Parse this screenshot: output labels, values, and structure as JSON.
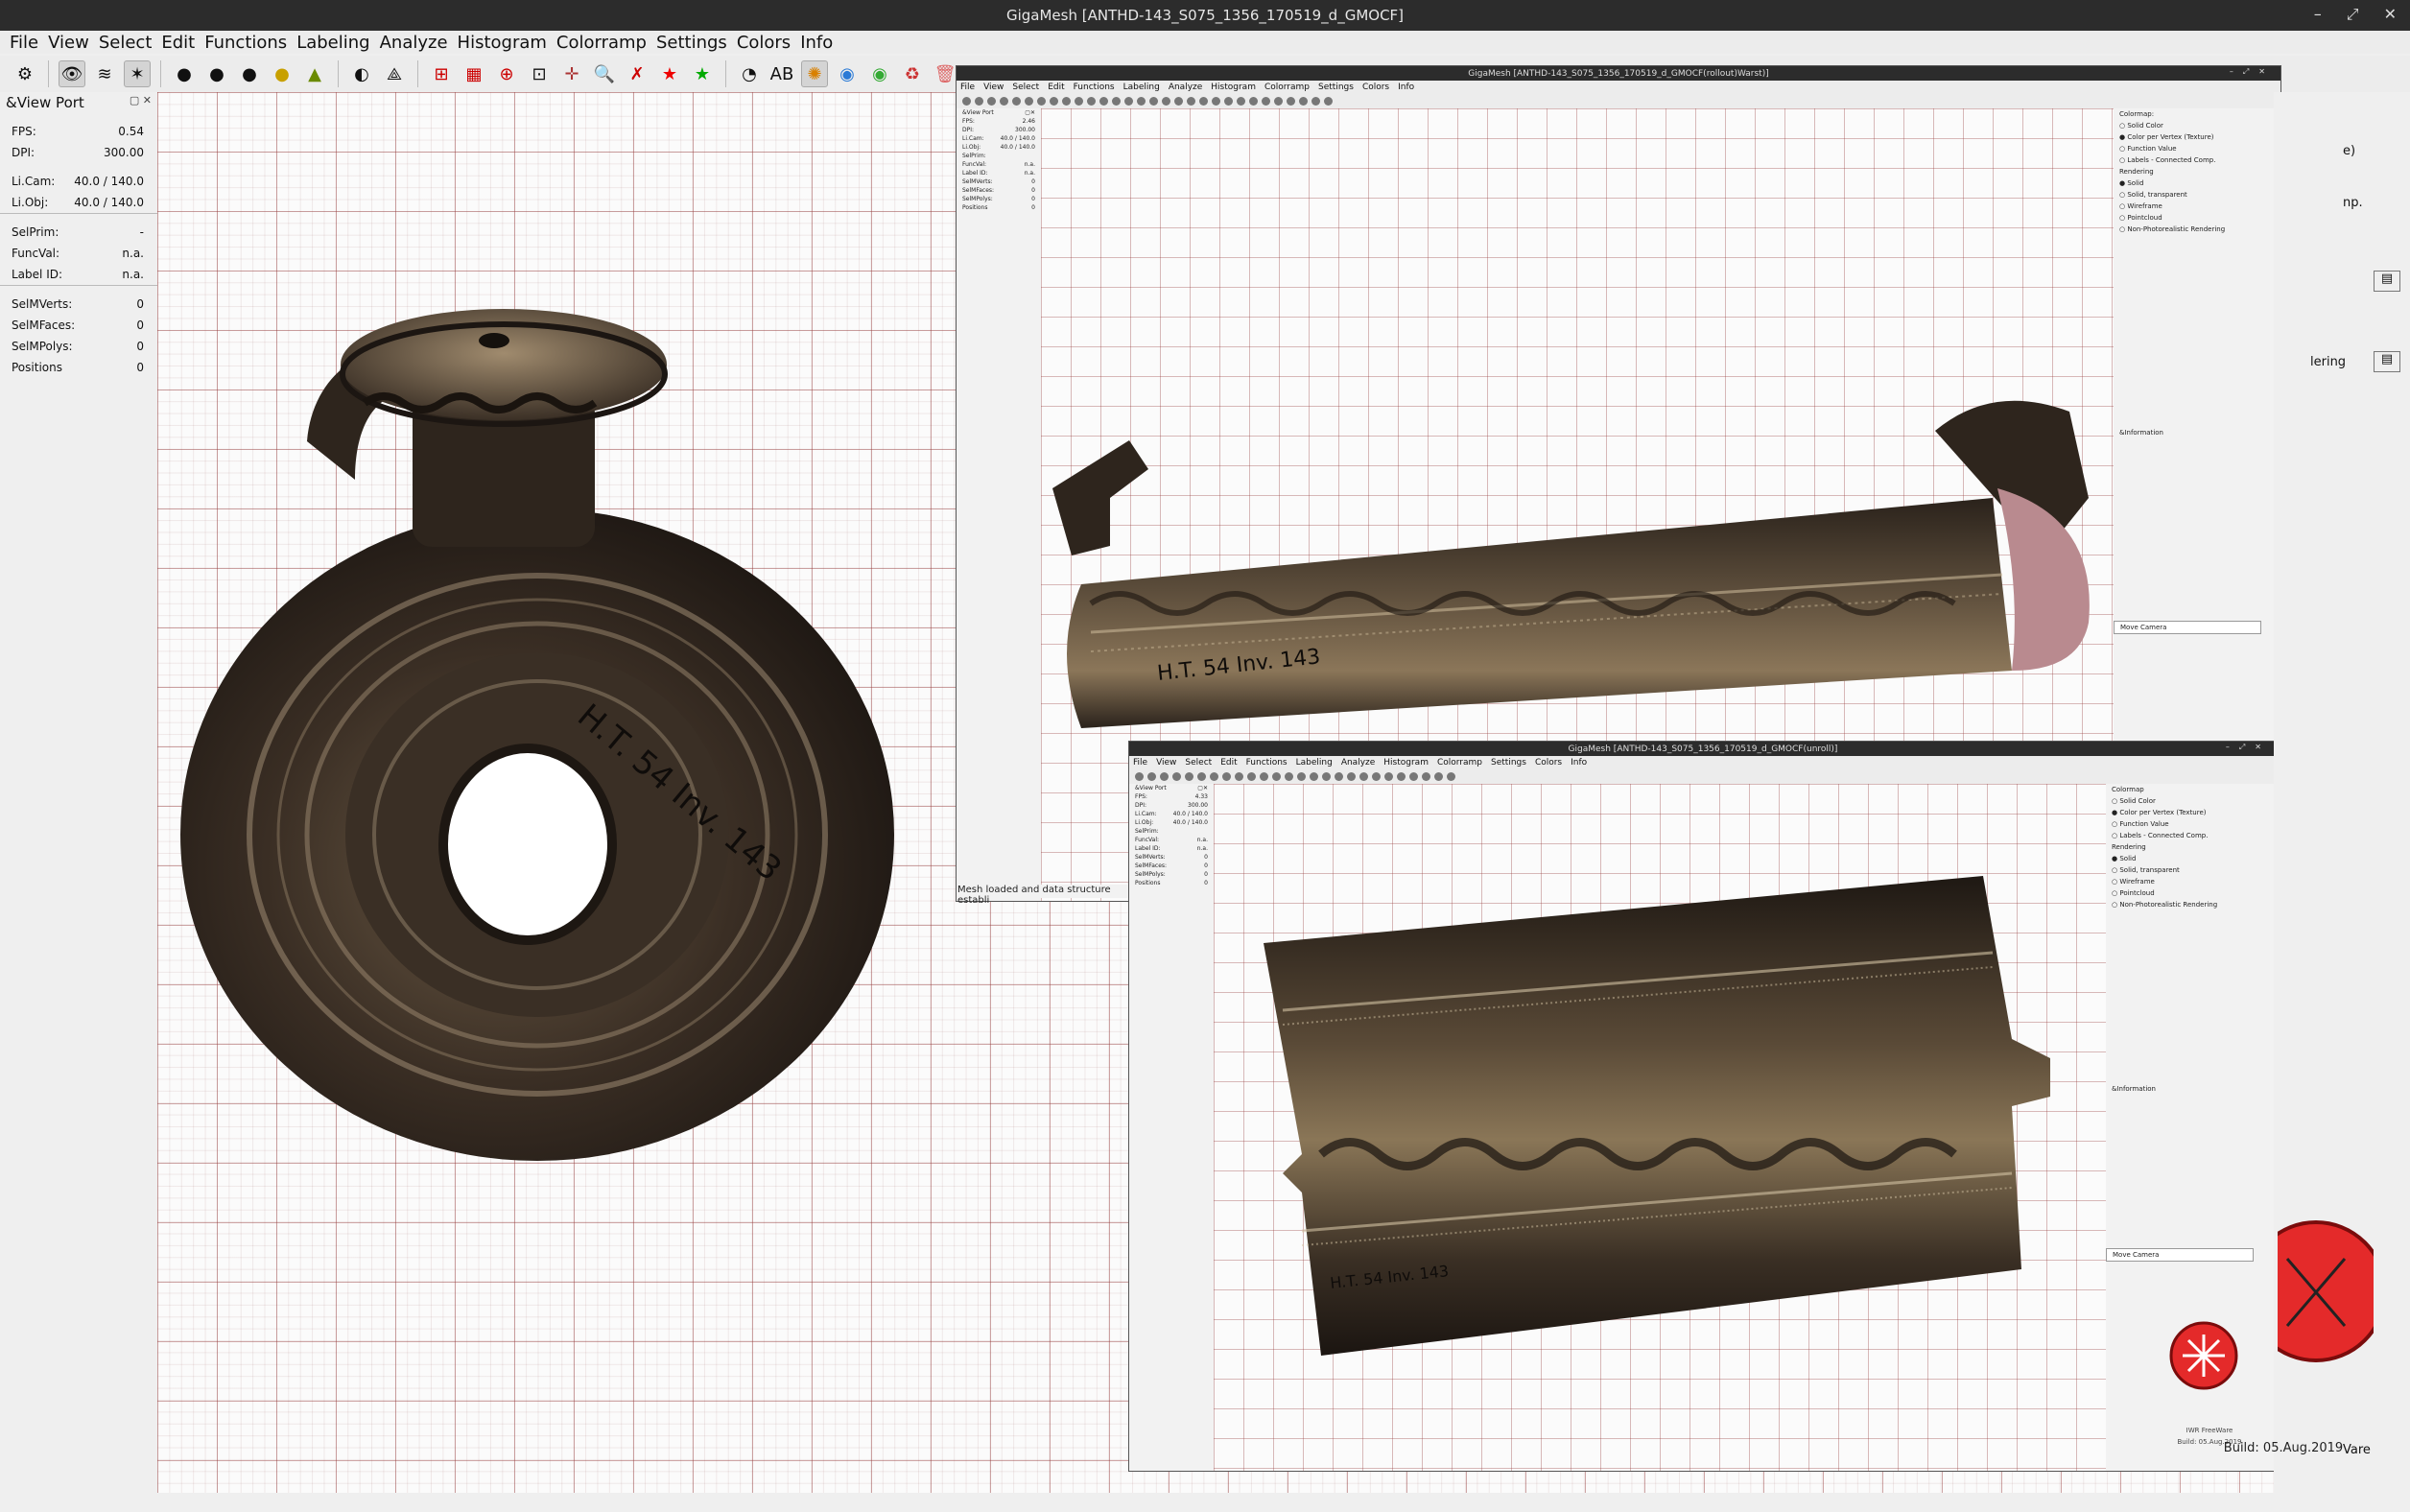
{
  "window": {
    "title": "GigaMesh [ANTHD-143_S075_1356_170519_d_GMOCF]"
  },
  "menu": [
    "File",
    "View",
    "Select",
    "Edit",
    "Functions",
    "Labeling",
    "Analyze",
    "Histogram",
    "Colorramp",
    "Settings",
    "Colors",
    "Info"
  ],
  "dock": {
    "title": "&View Port",
    "rows": [
      {
        "label": "FPS:",
        "value": "0.54"
      },
      {
        "label": "DPI:",
        "value": "300.00"
      },
      {
        "label": "Li.Cam:",
        "value": "40.0 / 140.0"
      },
      {
        "label": "Li.Obj:",
        "value": "40.0 / 140.0"
      },
      {
        "label": "SelPrim:",
        "value": "-"
      },
      {
        "label": "FuncVal:",
        "value": "n.a."
      },
      {
        "label": "Label ID:",
        "value": "n.a."
      },
      {
        "label": "SelMVerts:",
        "value": "0"
      },
      {
        "label": "SelMFaces:",
        "value": "0"
      },
      {
        "label": "SelMPolys:",
        "value": "0"
      },
      {
        "label": "Positions",
        "value": "0"
      }
    ]
  },
  "win1": {
    "title": "GigaMesh [ANTHD-143_S075_1356_170519_d_GMOCF(rollout)Warst)]",
    "dock_title": "&View Port",
    "rows": [
      {
        "label": "FPS:",
        "value": "2.46"
      },
      {
        "label": "DPI:",
        "value": "300.00"
      },
      {
        "label": "Li.Cam:",
        "value": "40.0 / 140.0"
      },
      {
        "label": "Li.Obj:",
        "value": "40.0 / 140.0"
      },
      {
        "label": "SelPrim:",
        "value": ""
      },
      {
        "label": "FuncVal:",
        "value": "n.a."
      },
      {
        "label": "Label ID:",
        "value": "n.a."
      },
      {
        "label": "SelMVerts:",
        "value": "0"
      },
      {
        "label": "SelMFaces:",
        "value": "0"
      },
      {
        "label": "SelMPolys:",
        "value": "0"
      },
      {
        "label": "Positions",
        "value": "0"
      }
    ],
    "right": [
      "Colormap:",
      "Solid Color",
      "Color per Vertex (Texture)",
      "Function Value",
      "Labels - Connected Comp.",
      "Rendering",
      "Solid",
      "Solid, transparent",
      "Wireframe",
      "Pointcloud",
      "Non-Photorealistic Rendering"
    ],
    "info_label": "&Information",
    "select": "Move Camera",
    "status": "Mesh loaded and data structure establi"
  },
  "win2": {
    "title": "GigaMesh [ANTHD-143_S075_1356_170519_d_GMOCF(unroll)]",
    "dock_title": "&View Port",
    "rows": [
      {
        "label": "FPS:",
        "value": "4.33"
      },
      {
        "label": "DPI:",
        "value": "300.00"
      },
      {
        "label": "Li.Cam:",
        "value": "40.0 / 140.0"
      },
      {
        "label": "Li.Obj:",
        "value": "40.0 / 140.0"
      },
      {
        "label": "SelPrim:",
        "value": ""
      },
      {
        "label": "FuncVal:",
        "value": "n.a."
      },
      {
        "label": "Label ID:",
        "value": "n.a."
      },
      {
        "label": "SelMVerts:",
        "value": "0"
      },
      {
        "label": "SelMFaces:",
        "value": "0"
      },
      {
        "label": "SelMPolys:",
        "value": "0"
      },
      {
        "label": "Positions",
        "value": "0"
      }
    ],
    "right": [
      "Colormap",
      "Solid Color",
      "Color per Vertex (Texture)",
      "Function Value",
      "Labels - Connected Comp.",
      "Rendering",
      "Solid",
      "Solid, transparent",
      "Wireframe",
      "Pointcloud",
      "Non-Photorealistic Rendering"
    ],
    "info_label": "&Information",
    "select": "Move Camera",
    "footer1": "IWR FreeWare",
    "footer2": "Build: 05.Aug.2019"
  },
  "background_right": {
    "partial1": "e)",
    "partial2": "np.",
    "partial3": "lering",
    "partial4": "Vare",
    "build": "Build: 05.Aug.2019"
  },
  "inscription": "H.T. 54   Inv. 143"
}
